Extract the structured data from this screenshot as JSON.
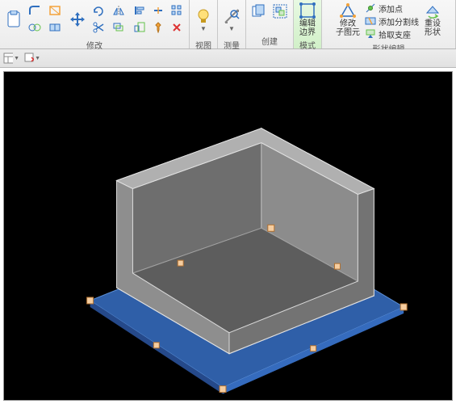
{
  "ribbon": {
    "groups": {
      "modify": {
        "label": "修改"
      },
      "view": {
        "label": "视图"
      },
      "measure": {
        "label": "测量"
      },
      "create": {
        "label": "创建"
      },
      "mode": {
        "label": "模式"
      },
      "shapeedit": {
        "label": "形状编辑"
      }
    },
    "buttons": {
      "edit_boundary": {
        "line1": "编辑",
        "line2": "边界"
      },
      "sub_element": {
        "line1": "修改",
        "line2": "子图元"
      },
      "reset_shape": {
        "line1": "重设",
        "line2": "形状"
      },
      "add_point": "添加点",
      "add_split_line": "添加分割线",
      "pick_support": "拾取支座"
    }
  },
  "colors": {
    "accent_blue": "#2f6fbf",
    "accent_green": "#63c24a",
    "accent_orange": "#f3a23a"
  }
}
